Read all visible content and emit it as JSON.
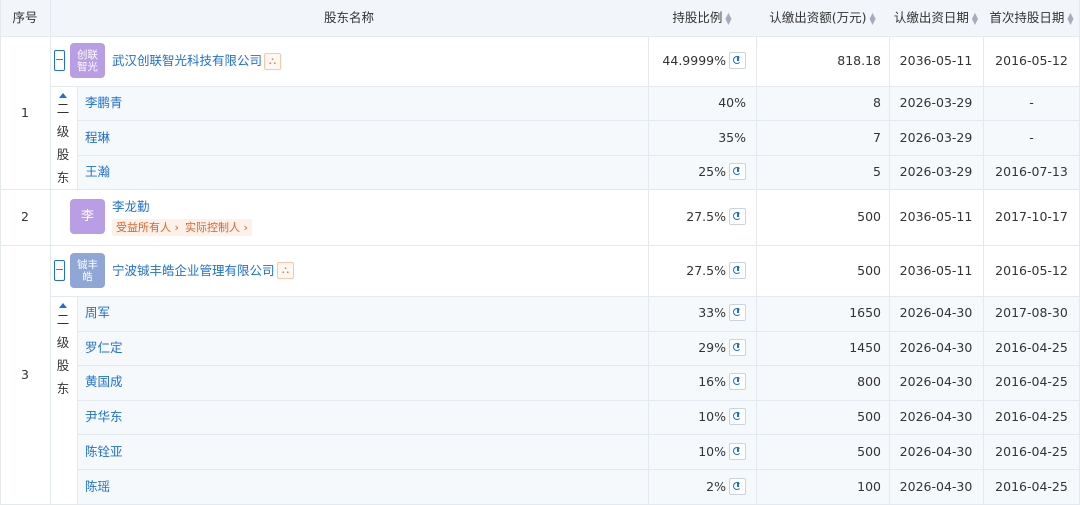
{
  "headers": {
    "index": "序号",
    "name": "股东名称",
    "ratio": "持股比例",
    "amount": "认缴出资额(万元)",
    "date": "认缴出资日期",
    "first": "首次持股日期"
  },
  "groups": [
    {
      "index": "1",
      "logo": "创联智光",
      "logo_color": "#b99ee6",
      "name": "武汉创联智光科技有限公司",
      "ratio": "44.9999%",
      "amount": "818.18",
      "date": "2036-05-11",
      "first": "2016-05-12",
      "sub_label": "二级股东",
      "subs": [
        {
          "name": "李鹏青",
          "ratio": "40%",
          "pie": false,
          "amount": "8",
          "date": "2026-03-29",
          "first": "-"
        },
        {
          "name": "程琳",
          "ratio": "35%",
          "pie": false,
          "amount": "7",
          "date": "2026-03-29",
          "first": "-"
        },
        {
          "name": "王瀚",
          "ratio": "25%",
          "pie": true,
          "amount": "5",
          "date": "2026-03-29",
          "first": "2016-07-13"
        }
      ]
    },
    {
      "index": "2",
      "logo": "李",
      "logo_color": "#b99ee6",
      "name": "李龙勤",
      "tags": [
        "受益所有人",
        "实际控制人"
      ],
      "ratio": "27.5%",
      "amount": "500",
      "date": "2036-05-11",
      "first": "2017-10-17"
    },
    {
      "index": "3",
      "logo": "铖丰皓",
      "logo_color": "#8fa6d6",
      "name": "宁波铖丰皓企业管理有限公司",
      "ratio": "27.5%",
      "amount": "500",
      "date": "2036-05-11",
      "first": "2016-05-12",
      "sub_label": "二级股东",
      "subs": [
        {
          "name": "周军",
          "ratio": "33%",
          "pie": true,
          "amount": "1650",
          "date": "2026-04-30",
          "first": "2017-08-30"
        },
        {
          "name": "罗仁定",
          "ratio": "29%",
          "pie": true,
          "amount": "1450",
          "date": "2026-04-30",
          "first": "2016-04-25"
        },
        {
          "name": "黄国成",
          "ratio": "16%",
          "pie": true,
          "amount": "800",
          "date": "2026-04-30",
          "first": "2016-04-25"
        },
        {
          "name": "尹华东",
          "ratio": "10%",
          "pie": true,
          "amount": "500",
          "date": "2026-04-30",
          "first": "2016-04-25"
        },
        {
          "name": "陈铨亚",
          "ratio": "10%",
          "pie": true,
          "amount": "500",
          "date": "2026-04-30",
          "first": "2016-04-25"
        },
        {
          "name": "陈瑶",
          "ratio": "2%",
          "pie": true,
          "amount": "100",
          "date": "2026-04-30",
          "first": "2016-04-25"
        }
      ]
    }
  ]
}
